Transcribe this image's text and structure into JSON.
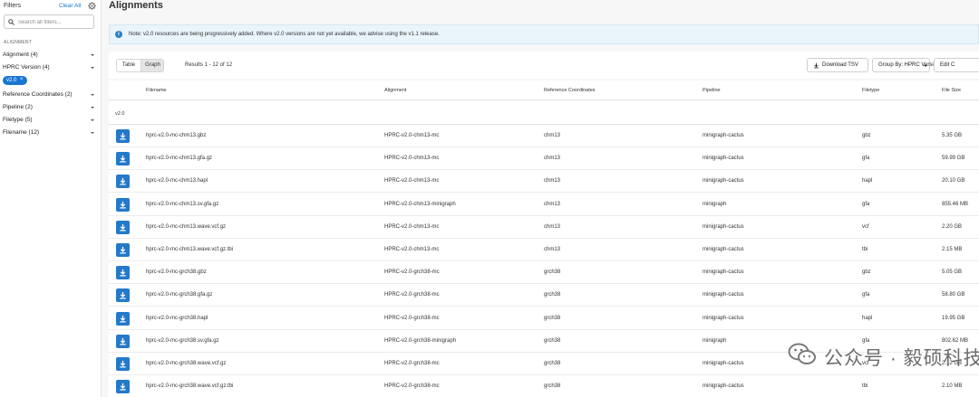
{
  "sidebar": {
    "title": "Filters",
    "clear_all": "Clear All",
    "search_placeholder": "Search all filters...",
    "section_label": "ALIGNMENT",
    "items": [
      {
        "label": "Alignment (4)"
      },
      {
        "label": "HPRC Version (4)"
      },
      {
        "label": "Reference Coordinates (2)"
      },
      {
        "label": "Pipeline (2)"
      },
      {
        "label": "Filetype (5)"
      },
      {
        "label": "Filename (12)"
      }
    ],
    "chip": "v2.0",
    "chip_remove": "×"
  },
  "page": {
    "title": "Alignments",
    "notice": "Note: v2.0 resources are being progressively added. Where v2.0 versions are not yet available, we advise using the v1.1 release."
  },
  "toolbar": {
    "tabs": [
      "Table",
      "Graph"
    ],
    "selected_tab": "Graph",
    "results": "Results 1 - 12 of 12",
    "download_tsv": "Download TSV",
    "group_by": "Group By: HPRC Version",
    "edit_columns": "Edit C"
  },
  "table": {
    "columns": [
      "Filename",
      "Alignment",
      "Reference Coordinates",
      "Pipeline",
      "Filetype",
      "File Size"
    ],
    "group": "v2.0",
    "rows": [
      [
        "hprc-v2.0-mc-chm13.gbz",
        "HPRC-v2.0-chm13-mc",
        "chm13",
        "minigraph-cactus",
        "gbz",
        "5.35 GB"
      ],
      [
        "hprc-v2.0-mc-chm13.gfa.gz",
        "HPRC-v2.0-chm13-mc",
        "chm13",
        "minigraph-cactus",
        "gfa",
        "59.99 GB"
      ],
      [
        "hprc-v2.0-mc-chm13.hapl",
        "HPRC-v2.0-chm13-mc",
        "chm13",
        "minigraph-cactus",
        "hapl",
        "20.10 GB"
      ],
      [
        "hprc-v2.0-mc-chm13.sv.gfa.gz",
        "HPRC-v2.0-chm13-minigraph",
        "chm13",
        "minigraph",
        "gfa",
        "855.46 MB"
      ],
      [
        "hprc-v2.0-mc-chm13.wave.vcf.gz",
        "HPRC-v2.0-chm13-mc",
        "chm13",
        "minigraph-cactus",
        "vcf",
        "2.20 GB"
      ],
      [
        "hprc-v2.0-mc-chm13.wave.vcf.gz.tbi",
        "HPRC-v2.0-chm13-mc",
        "chm13",
        "minigraph-cactus",
        "tbi",
        "2.15 MB"
      ],
      [
        "hprc-v2.0-mc-grch38.gbz",
        "HPRC-v2.0-grch38-mc",
        "grch38",
        "minigraph-cactus",
        "gbz",
        "5.05 GB"
      ],
      [
        "hprc-v2.0-mc-grch38.gfa.gz",
        "HPRC-v2.0-grch38-mc",
        "grch38",
        "minigraph-cactus",
        "gfa",
        "58.80 GB"
      ],
      [
        "hprc-v2.0-mc-grch38.hapl",
        "HPRC-v2.0-grch38-mc",
        "grch38",
        "minigraph-cactus",
        "hapl",
        "19.95 GB"
      ],
      [
        "hprc-v2.0-mc-grch38.sv.gfa.gz",
        "HPRC-v2.0-grch38-minigraph",
        "grch38",
        "minigraph",
        "gfa",
        "802.62 MB"
      ],
      [
        "hprc-v2.0-mc-grch38.wave.vcf.gz",
        "HPRC-v2.0-grch38-mc",
        "grch38",
        "minigraph-cactus",
        "vcf",
        "2.12 GB"
      ],
      [
        "hprc-v2.0-mc-grch38.wave.vcf.gz.tbi",
        "HPRC-v2.0-grch38-mc",
        "grch38",
        "minigraph-cactus",
        "tbi",
        "2.10 MB"
      ]
    ]
  },
  "watermark": {
    "text": "公众号 · 毅硕科技"
  },
  "colors": {
    "accent": "#1976d2",
    "download_button": "#2479c9",
    "notice_bg": "#e9f4fb"
  }
}
